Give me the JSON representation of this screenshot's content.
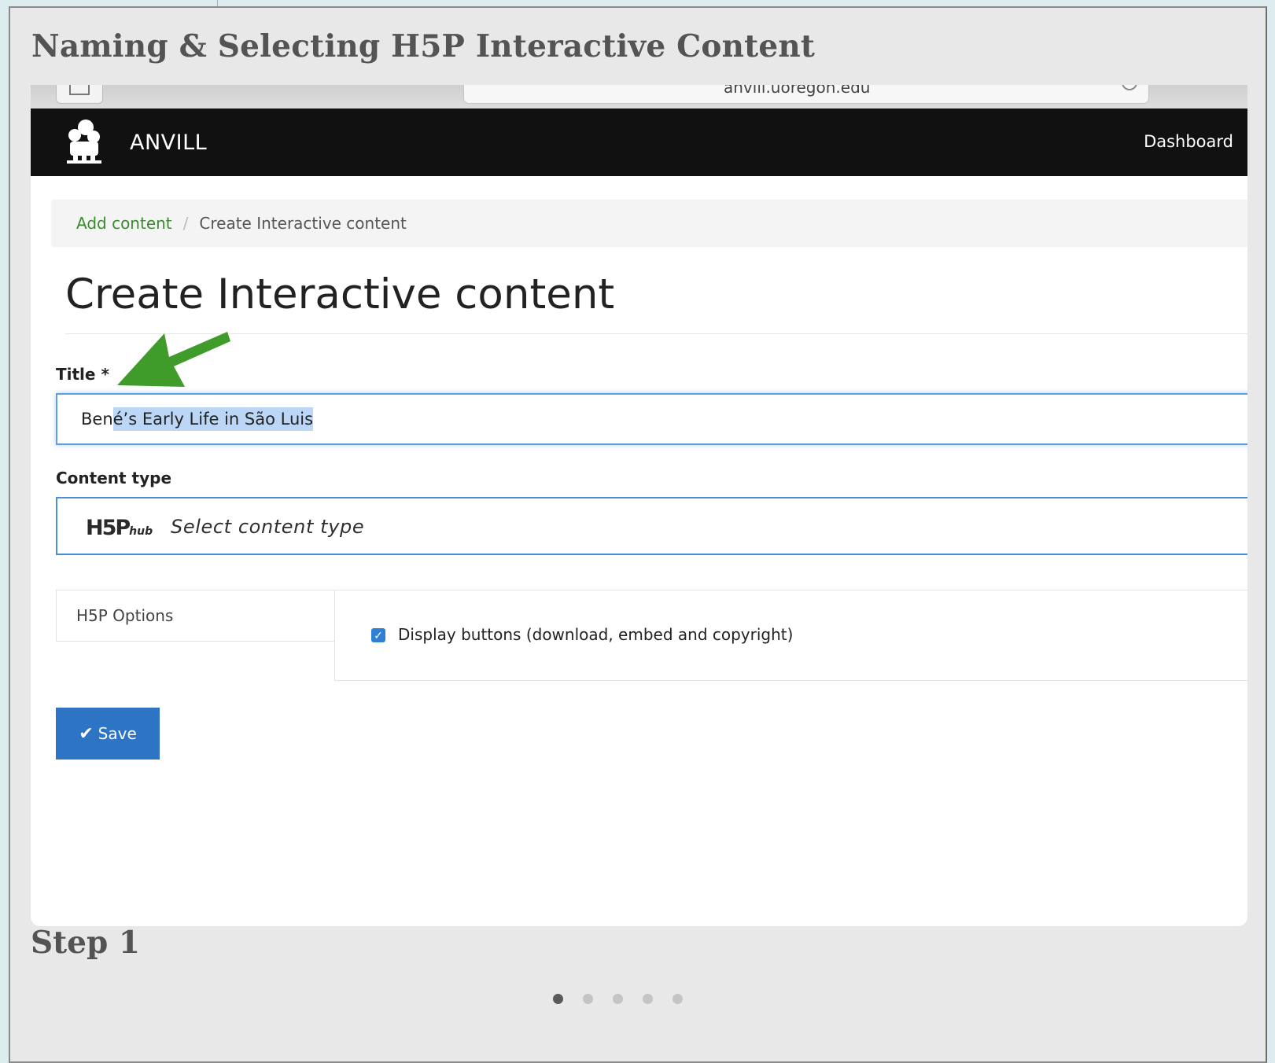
{
  "slide": {
    "title": "Naming & Selecting H5P Interactive Content",
    "caption": "Step 1",
    "pager": {
      "total": 5,
      "active": 1
    }
  },
  "browser": {
    "url": "anvill.uoregon.edu"
  },
  "site": {
    "name": "ANVILL",
    "nav_link": "Dashboard"
  },
  "breadcrumb": {
    "link": "Add content",
    "separator": "/",
    "current": "Create Interactive content"
  },
  "page": {
    "heading": "Create Interactive content"
  },
  "form": {
    "title_label": "Title *",
    "title_value_prefix": "Ben",
    "title_value_selected": "é’s Early Life in São Luis",
    "content_type_label": "Content type",
    "h5p_logo_text": "H5P",
    "h5p_logo_hub": "hub",
    "content_type_placeholder": "Select content type",
    "options_tab": "H5P Options",
    "display_buttons_label": "Display buttons (download, embed and copyright)",
    "save_label": "Save"
  },
  "colors": {
    "accent_blue": "#2d74c4",
    "link_green": "#3b8a2f",
    "arrow_green": "#3f9b2a",
    "navbar": "#111111"
  }
}
